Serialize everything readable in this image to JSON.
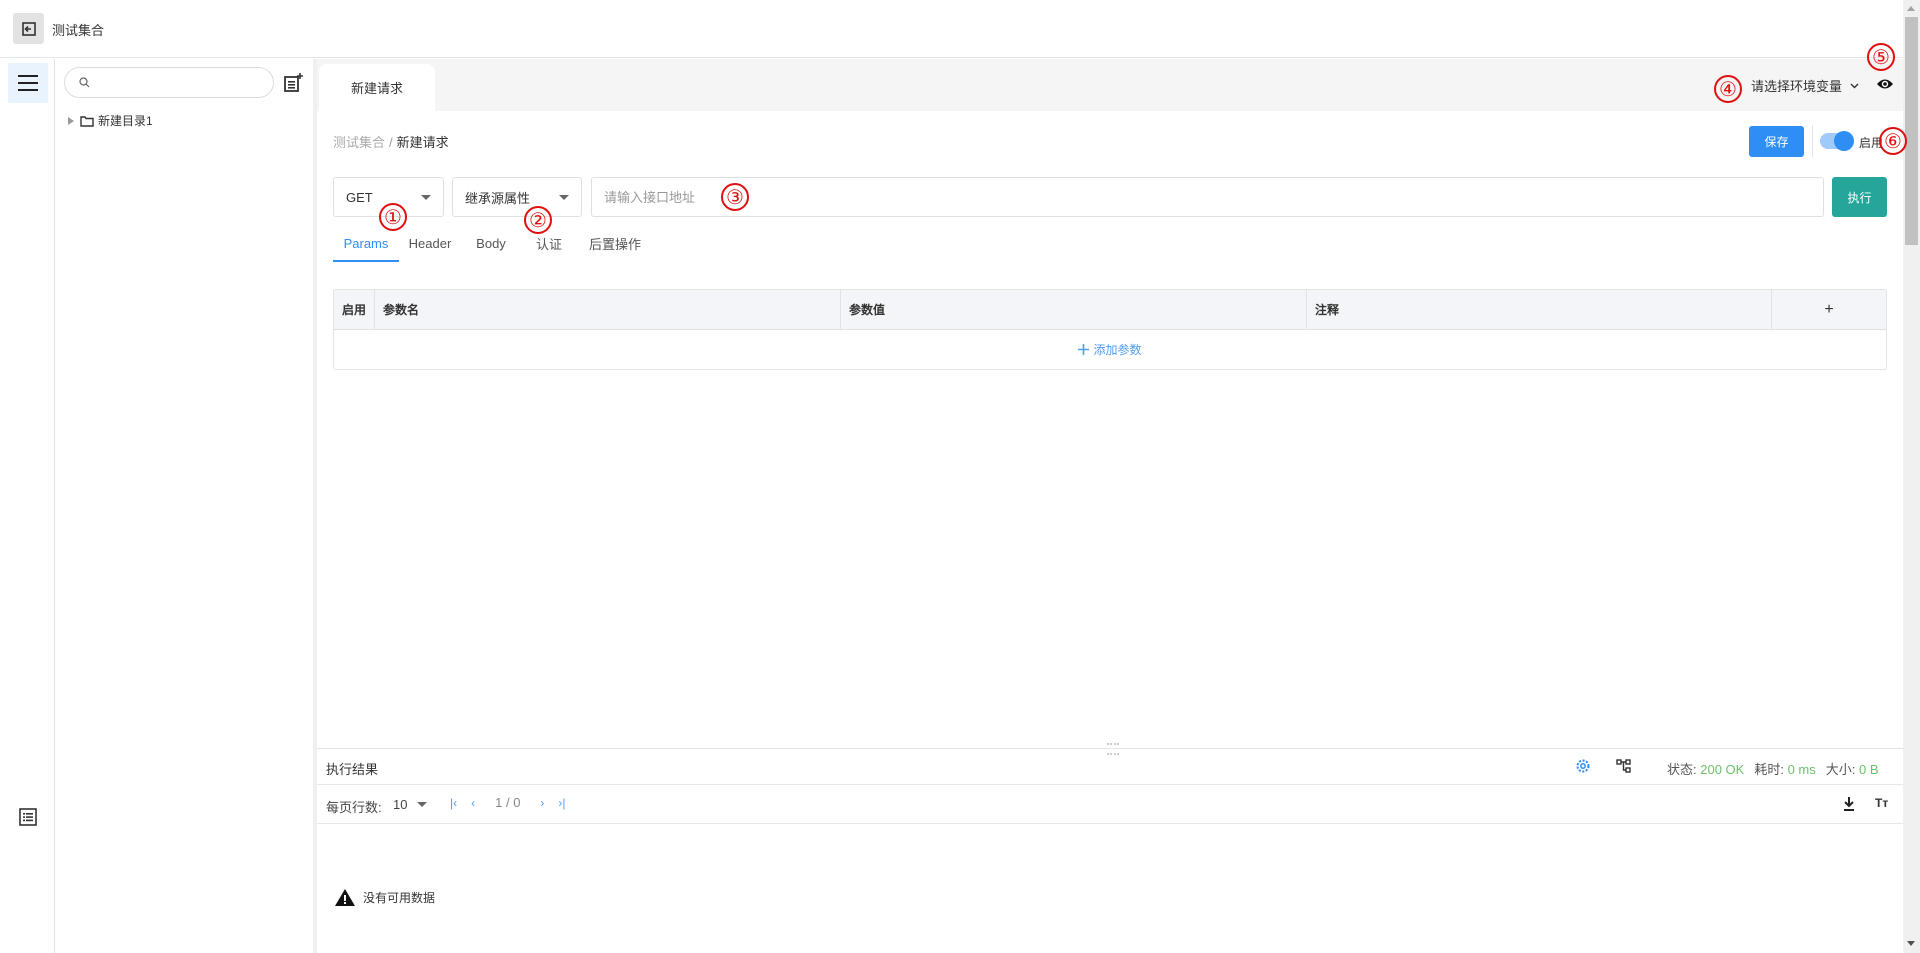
{
  "app": {
    "title": "测试集合",
    "back_icon": "exit-icon"
  },
  "rail": {
    "menu_icon": "hamburger-menu-icon",
    "list_icon": "list-icon"
  },
  "tree": {
    "search_placeholder": "",
    "search_value": "",
    "items": [
      {
        "label": "新建目录1",
        "type": "folder",
        "expanded": false
      }
    ]
  },
  "tabs": [
    {
      "label": "新建请求",
      "active": true
    }
  ],
  "env": {
    "selected": "请选择环境变量"
  },
  "breadcrumb": {
    "root": "测试集合",
    "separator": "/",
    "current": "新建请求"
  },
  "toolbar": {
    "save_label": "保存",
    "enable_label": "启用",
    "enabled": true
  },
  "request": {
    "method": "GET",
    "source": "继承源属性",
    "url_placeholder": "请输入接口地址",
    "url_value": "",
    "execute_label": "执行"
  },
  "subtabs": [
    {
      "label": "Params",
      "active": true
    },
    {
      "label": "Header",
      "active": false
    },
    {
      "label": "Body",
      "active": false
    },
    {
      "label": "认证",
      "active": false
    },
    {
      "label": "后置操作",
      "active": false
    }
  ],
  "params_table": {
    "columns": [
      "启用",
      "参数名",
      "参数值",
      "注释",
      "+"
    ],
    "rows": [],
    "add_label": "添加参数"
  },
  "results": {
    "title": "执行结果",
    "status_label": "状态:",
    "status_value": "200 OK",
    "time_label": "耗时:",
    "time_value": "0 ms",
    "size_label": "大小:",
    "size_value": "0 B",
    "rows_per_page_label": "每页行数:",
    "rows_per_page": "10",
    "page_indicator": "1 / 0",
    "empty_text": "没有可用数据",
    "font_toggle_label": "Tт"
  },
  "annotations": [
    "①",
    "②",
    "③",
    "④",
    "⑤",
    "⑥"
  ],
  "colors": {
    "primary": "#2f8ef4",
    "execute": "#26a69a",
    "success_text": "#6cc06a",
    "annotation": "#e01010"
  }
}
